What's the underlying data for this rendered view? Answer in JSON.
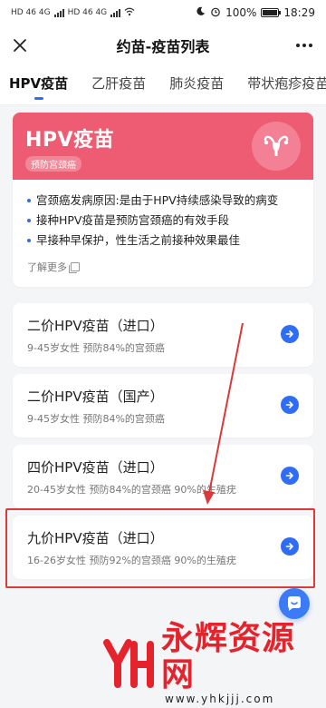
{
  "status_bar": {
    "time": "18:29",
    "battery": "100%",
    "network_left": "HD 46 4G",
    "network_right": "HD 46 4G"
  },
  "nav": {
    "title": "约苗-疫苗列表"
  },
  "tabs": [
    {
      "label": "HPV疫苗",
      "active": true
    },
    {
      "label": "乙肝疫苗",
      "active": false
    },
    {
      "label": "肺炎疫苗",
      "active": false
    },
    {
      "label": "带状疱疹疫苗",
      "active": false
    }
  ],
  "info_card": {
    "title": "HPV疫苗",
    "tag": "预防宫颈癌",
    "bullets": [
      "宫颈癌发病原因:是由于HPV持续感染导致的病变",
      "接种HPV疫苗是预防宫颈癌的有效手段",
      "早接种早保护，性生活之前接种效果最佳"
    ],
    "learn_more": "了解更多",
    "banner_color": "#ee5c73"
  },
  "vaccines": [
    {
      "name": "二价HPV疫苗（进口）",
      "desc": "9-45岁女性 预防84%的宫颈癌"
    },
    {
      "name": "二价HPV疫苗（国产）",
      "desc": "9-45岁女性 预防84%的宫颈癌"
    },
    {
      "name": "四价HPV疫苗（进口）",
      "desc": "20-45岁女性 预防84%的宫颈癌 90%的生殖疣"
    },
    {
      "name": "九价HPV疫苗（进口）",
      "desc": "16-26岁女性 预防92%的宫颈癌 90%的生殖疣"
    }
  ],
  "watermark": {
    "title": "永辉资源网",
    "url": "www.yhkjjj.com"
  },
  "colors": {
    "accent": "#2f6df6",
    "highlight": "#d93a3a",
    "watermark": "#e4232d"
  }
}
